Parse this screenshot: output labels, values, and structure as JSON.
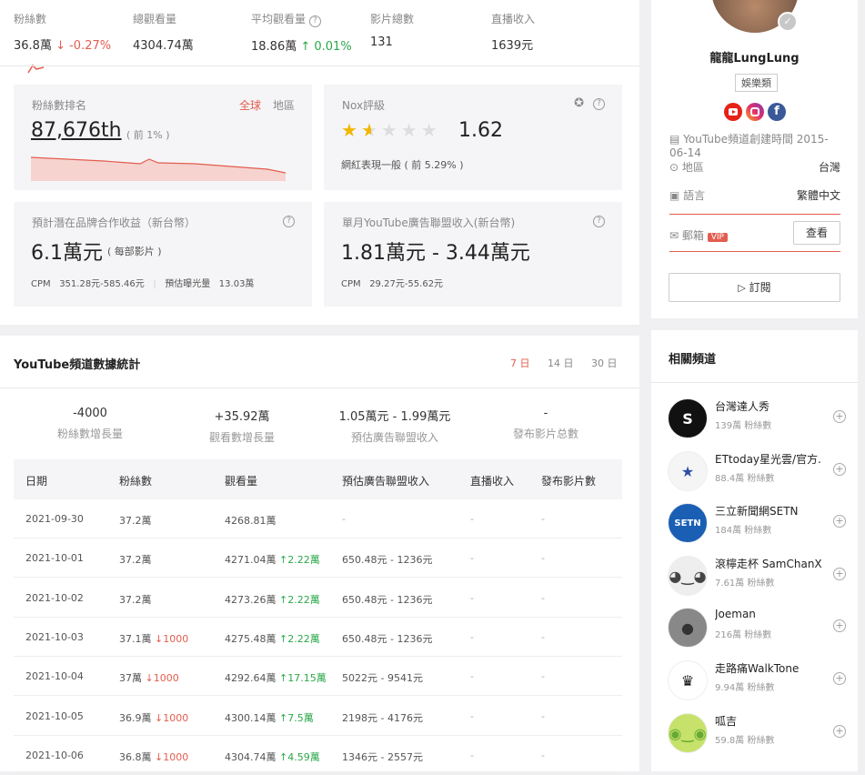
{
  "stats": [
    {
      "label": "粉絲數",
      "value": "36.8萬",
      "delta": "↓ -0.27%",
      "delta_dir": "down"
    },
    {
      "label": "總觀看量",
      "value": "4304.74萬",
      "delta": "",
      "delta_dir": ""
    },
    {
      "label": "平均觀看量",
      "value": "18.86萬",
      "delta": "↑ 0.01%",
      "delta_dir": "up"
    },
    {
      "label": "影片總數",
      "value": "131",
      "delta": "",
      "delta_dir": ""
    },
    {
      "label": "直播收入",
      "value": "1639元",
      "delta": "",
      "delta_dir": ""
    }
  ],
  "rank": {
    "title": "粉絲數排名",
    "value": "87,676th",
    "sub": "( 前 1% )",
    "tab_global": "全球",
    "tab_region": "地區"
  },
  "nox": {
    "title": "Nox評級",
    "score": "1.62",
    "stars": 1.5,
    "desc": "網紅表現一般 ( 前 5.29% )"
  },
  "brand": {
    "title": "預計潛在品牌合作收益（新台幣）",
    "value": "6.1萬元",
    "unit": "( 每部影片 )",
    "cpm_label": "CPM",
    "cpm": "351.28元-585.46元",
    "exp_label": "預估曝光量",
    "exp": "13.03萬"
  },
  "monthly": {
    "title": "單月YouTube廣告聯盟收入(新台幣)",
    "value": "1.81萬元 - 3.44萬元",
    "cpm_label": "CPM",
    "cpm": "29.27元-55.62元"
  },
  "yt": {
    "title": "YouTube頻道數據統計",
    "tabs": [
      "7 日",
      "14 日",
      "30 日"
    ],
    "summary": [
      {
        "value": "-4000",
        "label": "粉絲數增長量"
      },
      {
        "value": "+35.92萬",
        "label": "觀看數增長量"
      },
      {
        "value": "1.05萬元 - 1.99萬元",
        "label": "預估廣告聯盟收入"
      },
      {
        "value": "-",
        "label": "發布影片总數"
      }
    ],
    "headers": [
      "日期",
      "粉絲數",
      "觀看量",
      "預估廣告聯盟收入",
      "直播收入",
      "發布影片數"
    ],
    "rows": [
      {
        "date": "2021-09-30",
        "fans": "37.2萬",
        "fans_d": "",
        "fans_dir": "",
        "views": "4268.81萬",
        "views_d": "",
        "revenue": "-",
        "live": "-",
        "videos": "-"
      },
      {
        "date": "2021-10-01",
        "fans": "37.2萬",
        "fans_d": "",
        "fans_dir": "",
        "views": "4271.04萬",
        "views_d": "2.22萬",
        "revenue": "650.48元 - 1236元",
        "live": "-",
        "videos": "-"
      },
      {
        "date": "2021-10-02",
        "fans": "37.2萬",
        "fans_d": "",
        "fans_dir": "",
        "views": "4273.26萬",
        "views_d": "2.22萬",
        "revenue": "650.48元 - 1236元",
        "live": "-",
        "videos": "-"
      },
      {
        "date": "2021-10-03",
        "fans": "37.1萬",
        "fans_d": "1000",
        "fans_dir": "down",
        "views": "4275.48萬",
        "views_d": "2.22萬",
        "revenue": "650.48元 - 1236元",
        "live": "-",
        "videos": "-"
      },
      {
        "date": "2021-10-04",
        "fans": "37萬",
        "fans_d": "1000",
        "fans_dir": "down",
        "views": "4292.64萬",
        "views_d": "17.15萬",
        "revenue": "5022元 - 9541元",
        "live": "-",
        "videos": "-"
      },
      {
        "date": "2021-10-05",
        "fans": "36.9萬",
        "fans_d": "1000",
        "fans_dir": "down",
        "views": "4300.14萬",
        "views_d": "7.5萬",
        "revenue": "2198元 - 4176元",
        "live": "-",
        "videos": "-"
      },
      {
        "date": "2021-10-06",
        "fans": "36.8萬",
        "fans_d": "1000",
        "fans_dir": "down",
        "views": "4304.74萬",
        "views_d": "4.59萬",
        "revenue": "1346元 - 2557元",
        "live": "-",
        "videos": "-"
      }
    ]
  },
  "profile": {
    "name": "龍龍LungLung",
    "category": "娛樂類",
    "created": "YouTube頻道創建時間 2015-06-14",
    "region_label": "地區",
    "region": "台灣",
    "lang_label": "語言",
    "lang": "繁體中文",
    "email_label": "郵箱",
    "vip": "VIP",
    "view_btn": "查看",
    "subscribe": "訂閱"
  },
  "related": {
    "title": "相關頻道",
    "items": [
      {
        "name": "台灣達人秀",
        "sub": "139萬 粉絲數",
        "color": "#111111",
        "avatar_icon": "s-logo-icon"
      },
      {
        "name": "ETtoday星光雲/官方...",
        "sub": "88.4萬 粉絲數",
        "color": "#f5f5f5",
        "avatar_icon": "ettoday-star-icon"
      },
      {
        "name": "三立新聞網SETN",
        "sub": "184萬 粉絲數",
        "color": "#1a5fb4",
        "avatar_icon": "setn-icon"
      },
      {
        "name": "滾檸走杯 SamChanX",
        "sub": "7.61萬 粉絲數",
        "color": "#eeeeee",
        "avatar_icon": "bear-icon"
      },
      {
        "name": "Joeman",
        "sub": "216萬 粉絲數",
        "color": "#888888",
        "avatar_icon": "person-icon"
      },
      {
        "name": "走路痛WalkTone",
        "sub": "9.94萬 粉絲數",
        "color": "#ffffff",
        "avatar_icon": "crown-logo-icon"
      },
      {
        "name": "呱吉",
        "sub": "59.8萬 粉絲數",
        "color": "#c6e26b",
        "avatar_icon": "frog-icon"
      }
    ]
  }
}
